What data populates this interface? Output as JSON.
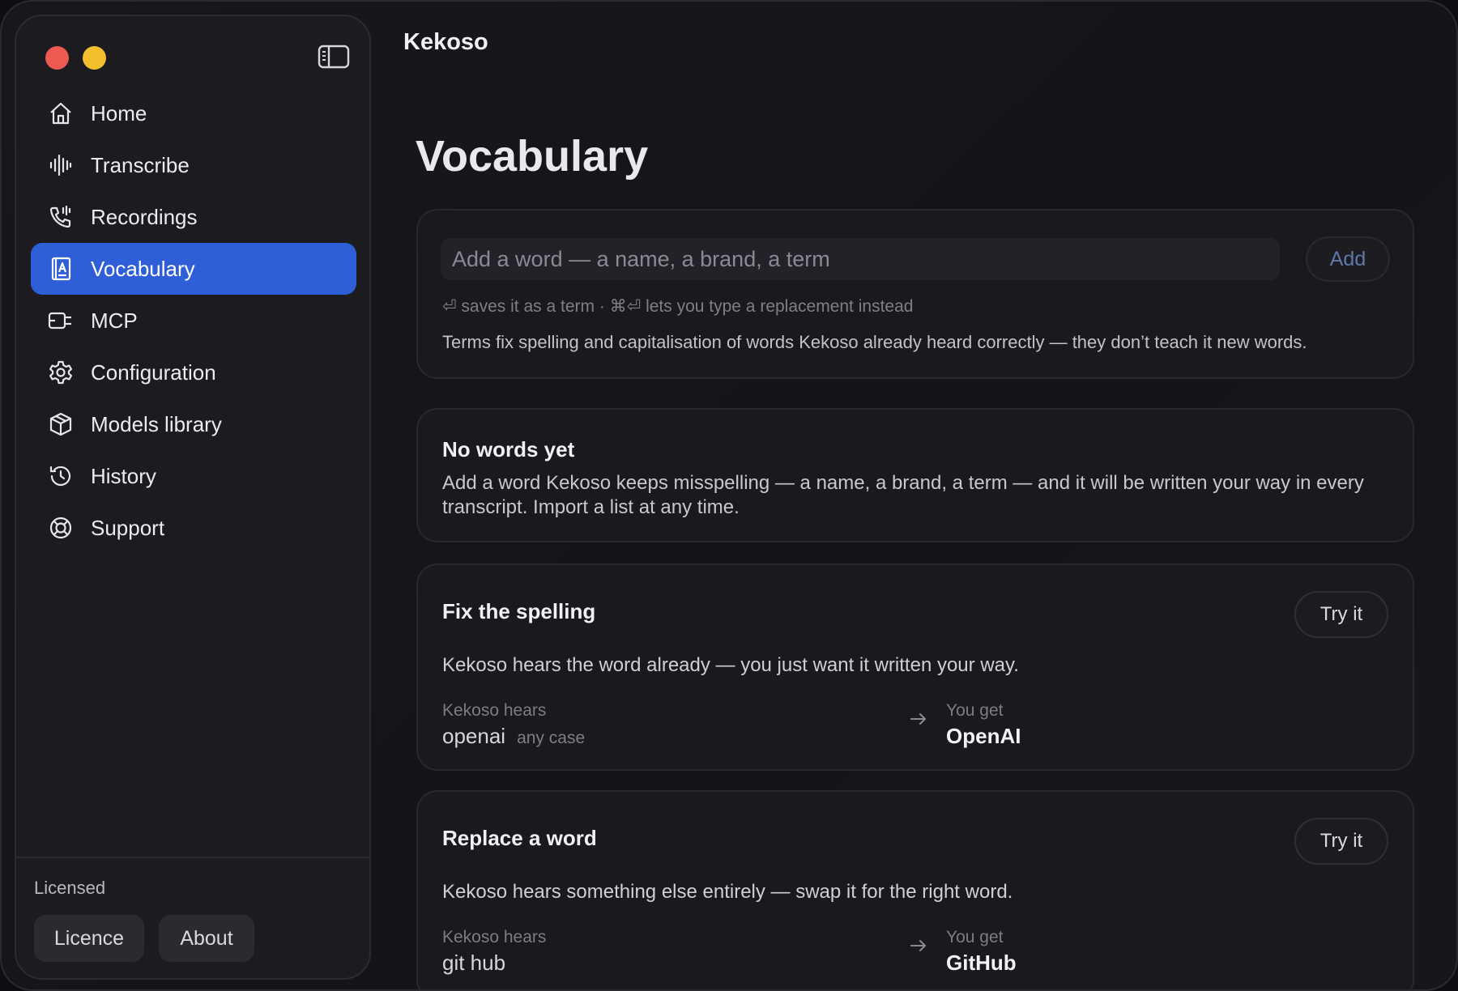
{
  "app": {
    "title": "Kekoso"
  },
  "sidebar": {
    "items": [
      {
        "label": "Home",
        "icon": "home-icon"
      },
      {
        "label": "Transcribe",
        "icon": "waveform-icon"
      },
      {
        "label": "Recordings",
        "icon": "phone-recording-icon"
      },
      {
        "label": "Vocabulary",
        "icon": "vocabulary-book-icon",
        "active": true
      },
      {
        "label": "MCP",
        "icon": "plug-icon"
      },
      {
        "label": "Configuration",
        "icon": "gear-icon"
      },
      {
        "label": "Models library",
        "icon": "cube-icon"
      },
      {
        "label": "History",
        "icon": "history-icon"
      },
      {
        "label": "Support",
        "icon": "lifebuoy-icon"
      }
    ],
    "footer": {
      "status": "Licensed",
      "licence_label": "Licence",
      "about_label": "About"
    }
  },
  "page": {
    "title": "Vocabulary"
  },
  "add_card": {
    "placeholder": "Add a word — a name, a brand, a term",
    "add_label": "Add",
    "hint": "⏎ saves it as a term · ⌘⏎ lets you type a replacement instead",
    "note": "Terms fix spelling and capitalisation of words Kekoso already heard correctly — they don’t teach it new words."
  },
  "empty_card": {
    "heading": "No words yet",
    "body": "Add a word Kekoso keeps misspelling — a name, a brand, a term — and it will be written your way in every transcript. Import a list at any time."
  },
  "examples": [
    {
      "heading": "Fix the spelling",
      "try_label": "Try it",
      "description": "Kekoso hears the word already — you just want it written your way.",
      "hears_label": "Kekoso hears",
      "hears_value": "openai",
      "case_note": "any case",
      "get_label": "You get",
      "get_value": "OpenAI"
    },
    {
      "heading": "Replace a word",
      "try_label": "Try it",
      "description": "Kekoso hears something else entirely — swap it for the right word.",
      "hears_label": "Kekoso hears",
      "hears_value": "git hub",
      "get_label": "You get",
      "get_value": "GitHub"
    }
  ],
  "colors": {
    "accent": "#2f5fd8",
    "close": "#ee5a52",
    "minimize": "#f3bf2f"
  }
}
